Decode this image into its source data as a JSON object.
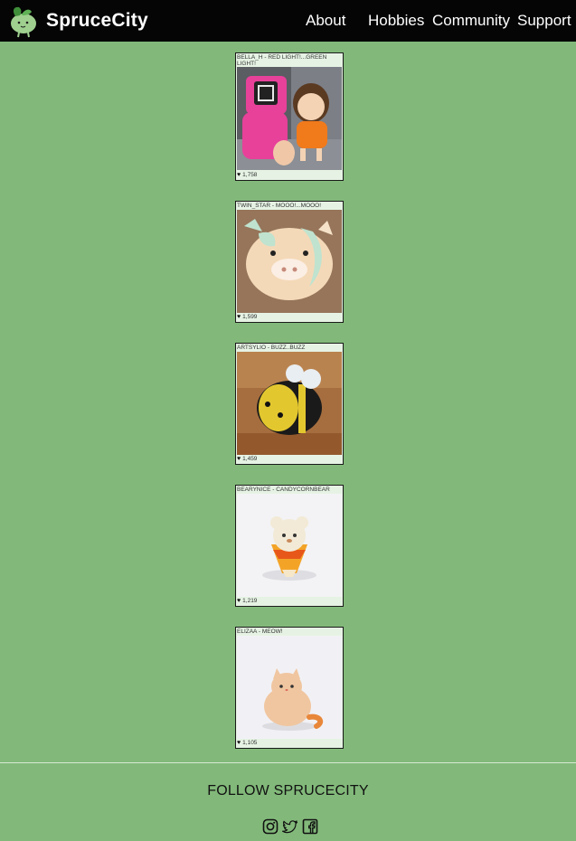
{
  "brand": {
    "name": "SpruceCity"
  },
  "nav": {
    "about": "About",
    "hobbies": "Hobbies",
    "community": "Community",
    "support": "Support"
  },
  "posts": [
    {
      "title": "BELLA_H - RED LIGHT!...GREEN LIGHT!",
      "likes": "1,758",
      "image": "crochet dolls in pink jumpsuit and orange dress"
    },
    {
      "title": "TWIN_STAR - MOOO!...MOOO!",
      "likes": "1,599",
      "image": "crochet cow plush"
    },
    {
      "title": "ARTSYLIO - BUZZ..BUZZ",
      "likes": "1,459",
      "image": "crochet bee plush"
    },
    {
      "title": "BEARYNICE - CANDYCORNBEAR",
      "likes": "1,219",
      "image": "crochet candy corn bear"
    },
    {
      "title": "ELIZAA - MEOW!",
      "likes": "1,105",
      "image": "crochet orange cat"
    }
  ],
  "footer": {
    "follow": "FOLLOW SPRUCECITY"
  },
  "icons": {
    "logo": "leaf-sprout-icon",
    "like": "heart-icon",
    "social": [
      "instagram-icon",
      "twitter-icon",
      "facebook-icon"
    ]
  },
  "colors": {
    "background": "#82b97a",
    "navbar": "#050505",
    "card": "#e6f3e4"
  }
}
